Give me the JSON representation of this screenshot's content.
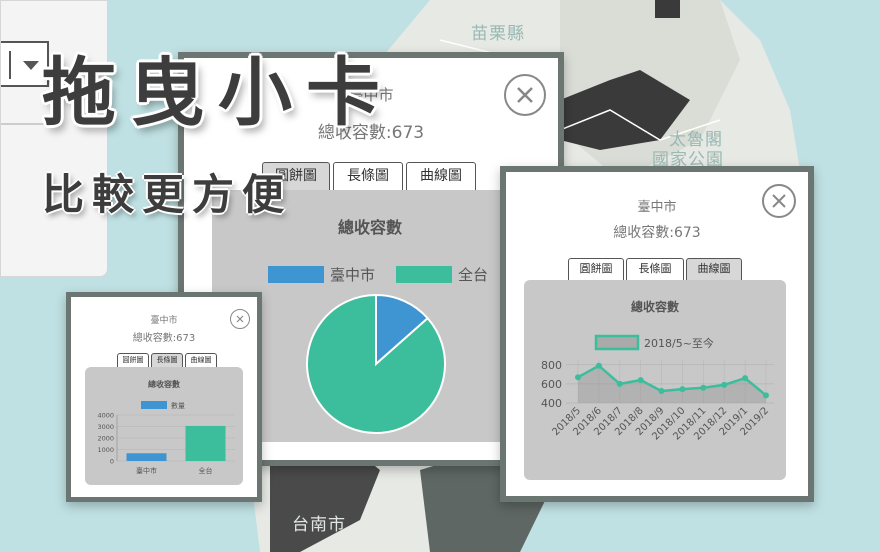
{
  "map": {
    "labels": [
      "苗栗縣",
      "太魯閣",
      "國家公園",
      "台南市"
    ]
  },
  "headline": {
    "title": "拖曳小卡",
    "subtitle": "比較更方便"
  },
  "card_center": {
    "title": "臺中市",
    "subtitle": "總收容數:673",
    "tabs": [
      "圓餅圖",
      "長條圖",
      "曲線圖"
    ],
    "active_tab": 0,
    "chart_data": {
      "type": "pie",
      "title": "總收容數",
      "categories": [
        "臺中市",
        "全台"
      ],
      "colors": [
        "#3e95d2",
        "#3cbd9c"
      ],
      "values": [
        673,
        4327
      ]
    }
  },
  "card_right": {
    "title": "臺中市",
    "subtitle": "總收容數:673",
    "tabs": [
      "圓餅圖",
      "長條圖",
      "曲線圖"
    ],
    "active_tab": 2,
    "chart_data": {
      "type": "line",
      "title": "總收容數",
      "series": [
        {
          "name": "2018/5~至今",
          "color": "#3cbd9c",
          "values": [
            670,
            790,
            600,
            640,
            525,
            545,
            560,
            590,
            660,
            480
          ]
        }
      ],
      "categories": [
        "2018/5",
        "2018/6",
        "2018/7",
        "2018/8",
        "2018/9",
        "2018/10",
        "2018/11",
        "2018/12",
        "2019/1",
        "2019/2"
      ],
      "yticks": [
        400,
        600,
        800
      ],
      "ylim": [
        400,
        850
      ]
    }
  },
  "card_small": {
    "title": "臺中市",
    "subtitle": "總收容數:673",
    "tabs": [
      "圓餅圖",
      "長條圖",
      "曲線圖"
    ],
    "active_tab": 1,
    "chart_data": {
      "type": "bar",
      "title": "總收容數",
      "categories": [
        "臺中市",
        "全台"
      ],
      "series": [
        {
          "name": "數量",
          "color": "#3e95d2",
          "values": [
            673,
            3050
          ]
        }
      ],
      "colors": [
        "#3e95d2",
        "#3cbd9c"
      ],
      "yticks": [
        0,
        1000,
        2000,
        3000,
        4000
      ],
      "ylim": [
        0,
        4000
      ]
    }
  }
}
